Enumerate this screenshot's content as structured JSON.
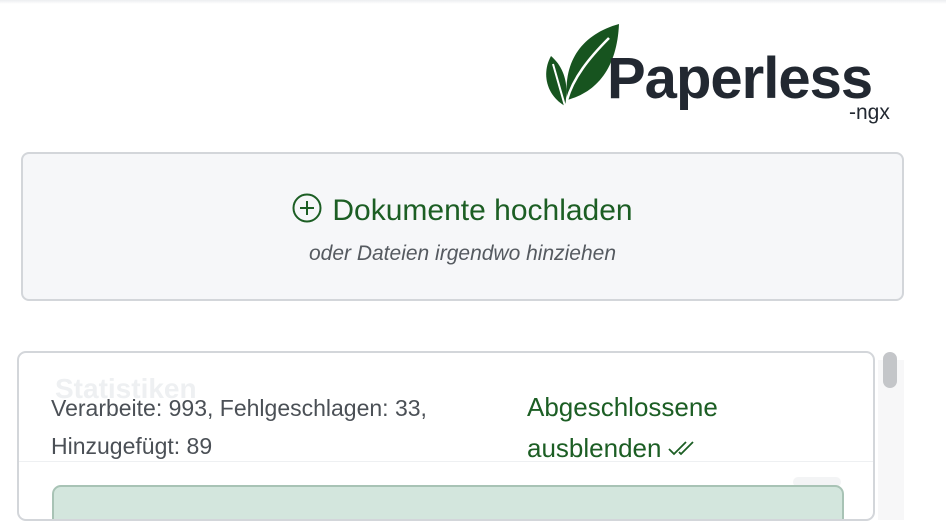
{
  "logo": {
    "name": "Paperless",
    "suffix": "-ngx",
    "icon": "leaf-icon",
    "text_color": "#222831",
    "leaf_color": "#17541f"
  },
  "upload": {
    "title": "Dokumente hochladen",
    "subtitle": "oder Dateien irgendwo hinziehen",
    "icon": "plus-circle-icon",
    "accent": "#1c5e24"
  },
  "stats": {
    "header": "Statistiken",
    "summary_line1": "Verarbeite: 993, Fehlgeschlagen: 33,",
    "summary_line2": "Hinzugefügt: 89",
    "hide_completed_line1": "Abgeschlossene",
    "hide_completed_line2": "ausblenden",
    "hide_icon": "double-check-icon"
  }
}
